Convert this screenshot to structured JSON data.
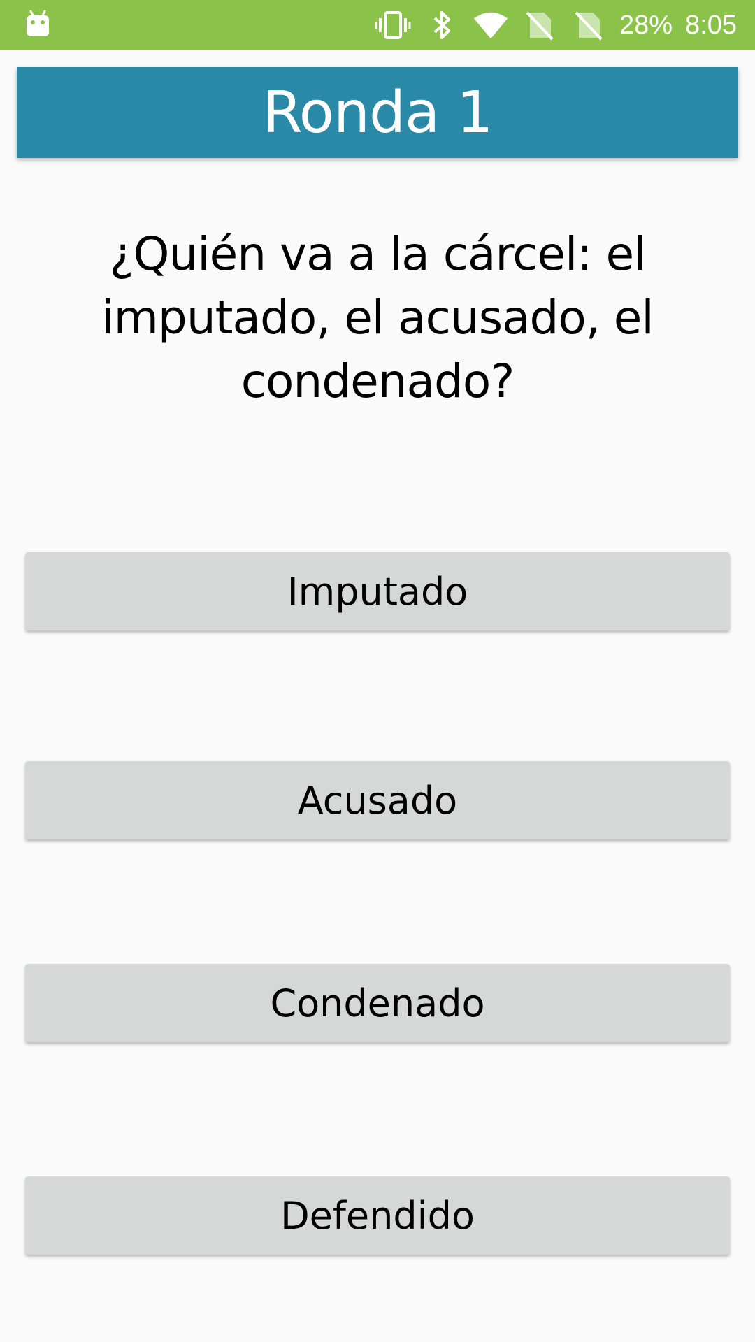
{
  "status_bar": {
    "battery": "28%",
    "time": "8:05",
    "background_color": "#8bc34a",
    "icons": [
      "android-debug-icon",
      "vibrate-icon",
      "bluetooth-icon",
      "wifi-icon",
      "no-sim-icon",
      "no-sim-icon"
    ]
  },
  "header": {
    "title": "Ronda 1",
    "background_color": "#2b89a8"
  },
  "question": {
    "text": "¿Quién va a la cárcel: el imputado, el acusado, el condenado?"
  },
  "answers": [
    {
      "label": "Imputado"
    },
    {
      "label": "Acusado"
    },
    {
      "label": "Condenado"
    },
    {
      "label": "Defendido"
    }
  ]
}
